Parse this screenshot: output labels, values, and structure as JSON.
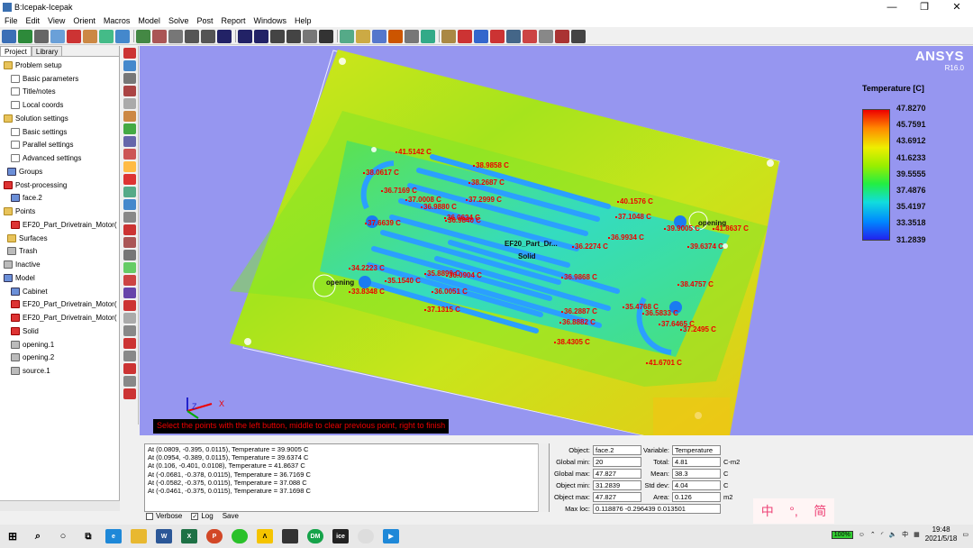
{
  "window": {
    "title": "B:Icepak-Icepak"
  },
  "menu": [
    "File",
    "Edit",
    "View",
    "Orient",
    "Macros",
    "Model",
    "Solve",
    "Post",
    "Report",
    "Windows",
    "Help"
  ],
  "left_panel": {
    "tabs": [
      "Project",
      "Library"
    ],
    "tree": [
      {
        "label": "Problem setup",
        "icon": "folder"
      },
      {
        "label": "Basic parameters",
        "icon": "page"
      },
      {
        "label": "Title/notes",
        "icon": "page"
      },
      {
        "label": "Local coords",
        "icon": "page"
      },
      {
        "label": "Solution settings",
        "icon": "folder"
      },
      {
        "label": "Basic settings",
        "icon": "page"
      },
      {
        "label": "Parallel settings",
        "icon": "page"
      },
      {
        "label": "Advanced settings",
        "icon": "page"
      },
      {
        "label": "Groups",
        "icon": "blue"
      },
      {
        "label": "Post-processing",
        "icon": "red"
      },
      {
        "label": "face.2",
        "icon": "blue"
      },
      {
        "label": "Points",
        "icon": "folder"
      },
      {
        "label": "EF20_Part_Drivetrain_Motor(",
        "icon": "red"
      },
      {
        "label": "Surfaces",
        "icon": "folder"
      },
      {
        "label": "Trash",
        "icon": "gray"
      },
      {
        "label": "Inactive",
        "icon": "gray"
      },
      {
        "label": "Model",
        "icon": "blue"
      },
      {
        "label": "Cabinet",
        "icon": "blue"
      },
      {
        "label": "EF20_Part_Drivetrain_Motor(",
        "icon": "red"
      },
      {
        "label": "EF20_Part_Drivetrain_Motor(",
        "icon": "red"
      },
      {
        "label": "Solid",
        "icon": "red"
      },
      {
        "label": "opening.1",
        "icon": "gray"
      },
      {
        "label": "opening.2",
        "icon": "gray"
      },
      {
        "label": "source.1",
        "icon": "gray"
      }
    ]
  },
  "viewport": {
    "brand": "ANSYS",
    "version": "R16.0",
    "legend_title": "Temperature [C]",
    "legend_values": [
      "47.8270",
      "45.7591",
      "43.6912",
      "41.6233",
      "39.5555",
      "37.4876",
      "35.4197",
      "33.3518",
      "31.2839"
    ],
    "probes": [
      "41.5142 C",
      "38.9858 C",
      "38.0617 C",
      "38.2687 C",
      "36.7169 C",
      "37.0008 C",
      "36.9880 C",
      "37.2999 C",
      "36.0624 C",
      "37.6639 C",
      "36.9840 C",
      "40.1576 C",
      "37.1048 C",
      "39.9005 C",
      "41.8637 C",
      "36.2274 C",
      "36.9934 C",
      "39.6374 C",
      "34.2223 C",
      "35.8899 C",
      "36.0904 C",
      "35.1540 C",
      "36.0051 C",
      "33.8348 C",
      "36.9868 C",
      "37.1315 C",
      "36.2887 C",
      "38.4757 C",
      "35.4768 C",
      "36.5833 C",
      "36.8882 C",
      "37.6465 C",
      "37.2495 C",
      "38.4305 C",
      "41.6701 C"
    ],
    "labels": [
      "EF20_Part_Dr...",
      "Solid",
      "opening",
      "opening"
    ],
    "axis_z": "Z",
    "axis_x": "X",
    "hint": "Select the points with the left button, middle to clear previous point, right to finish"
  },
  "messages": [
    "At (0.0809, -0.395, 0.0115), Temperature =  39.9005 C",
    "At (0.0954, -0.389, 0.0115), Temperature =  39.6374 C",
    "At (0.106, -0.401, 0.0108), Temperature =  41.8637 C",
    "At (-0.0681, -0.378, 0.0115), Temperature =  36.7169 C",
    "At (-0.0582, -0.375, 0.0115), Temperature =  37.088 C",
    "At (-0.0461, -0.375, 0.0115), Temperature =  37.1698 C"
  ],
  "msg_footer": {
    "verbose": "Verbose",
    "log": "Log",
    "save": "Save"
  },
  "stats": {
    "object_label": "Object:",
    "object": "face.2",
    "variable_label": "Variable:",
    "variable": "Temperature",
    "global_min_label": "Global min:",
    "global_min": "20",
    "total_label": "Total:",
    "total": "4.81",
    "total_unit": "C-m2",
    "global_max_label": "Global max:",
    "global_max": "47.827",
    "mean_label": "Mean:",
    "mean": "38.3",
    "mean_unit": "C",
    "object_min_label": "Object min:",
    "object_min": "31.2839",
    "stddev_label": "Std dev:",
    "stddev": "4.04",
    "stddev_unit": "C",
    "object_max_label": "Object max:",
    "object_max": "47.827",
    "area_label": "Area:",
    "area": "0.126",
    "area_unit": "m2",
    "max_loc_label": "Max loc:",
    "max_loc": "0.118876 -0.296439 0.013501"
  },
  "watermark": {
    "c1": "中",
    "c2": "°,",
    "c3": "简"
  },
  "taskbar": {
    "battery": "100%",
    "lang": "中",
    "time": "19:48",
    "date": "2021/5/18"
  }
}
